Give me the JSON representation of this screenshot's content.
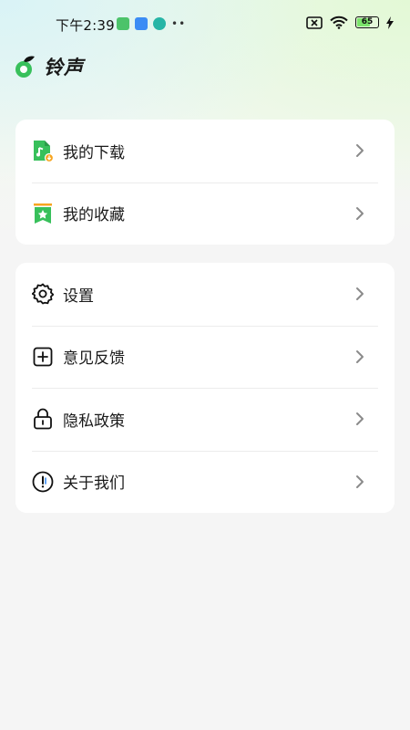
{
  "status_bar": {
    "time": "下午2:39",
    "battery": "65",
    "icons": [
      "app-notification-icon",
      "chat-icon",
      "info-icon",
      "more-dots-icon",
      "sim-off-icon",
      "wifi-icon",
      "battery-icon",
      "charging-icon"
    ]
  },
  "header": {
    "title": "铃声",
    "logo_icon": "leaf-note-logo"
  },
  "card1": {
    "items": [
      {
        "label": "我的下载",
        "icon": "download-file-icon"
      },
      {
        "label": "我的收藏",
        "icon": "bookmark-star-icon"
      }
    ]
  },
  "card2": {
    "items": [
      {
        "label": "设置",
        "icon": "gear-icon"
      },
      {
        "label": "意见反馈",
        "icon": "feedback-plus-icon"
      },
      {
        "label": "隐私政策",
        "icon": "lock-icon"
      },
      {
        "label": "关于我们",
        "icon": "about-info-icon"
      }
    ]
  },
  "colors": {
    "accent": "#38c05b",
    "accent_orange": "#f7a520",
    "background": "#f5f5f5",
    "card": "#ffffff"
  }
}
